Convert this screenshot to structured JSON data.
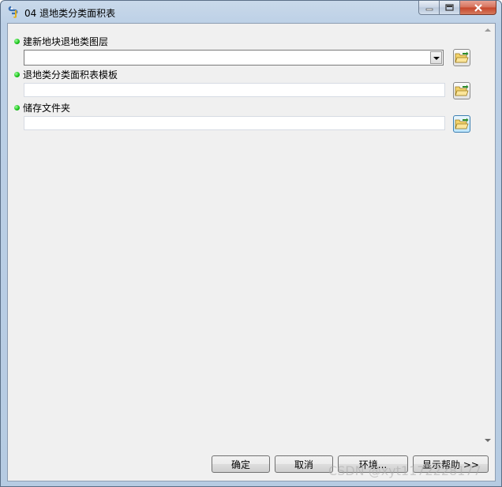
{
  "window": {
    "title": "04 退地类分类面积表",
    "icon": "python-script-icon"
  },
  "fields": [
    {
      "label": "建新地块退地类图层",
      "type": "combo",
      "value": ""
    },
    {
      "label": "退地类分类面积表模板",
      "type": "text",
      "value": ""
    },
    {
      "label": "储存文件夹",
      "type": "text",
      "value": ""
    }
  ],
  "buttons": {
    "ok": "确定",
    "cancel": "取消",
    "env": "环境...",
    "help": "显示帮助 >>"
  },
  "watermark": "CSDN @xyt1172228177",
  "colors": {
    "required_dot": "#17c017",
    "client_bg": "#f0f0f0",
    "frame": "#b6cbe2"
  }
}
